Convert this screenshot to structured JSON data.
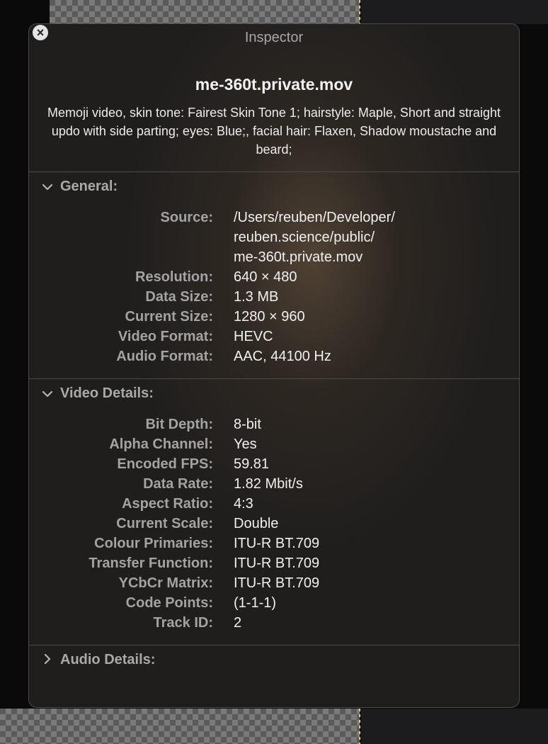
{
  "window": {
    "title": "Inspector",
    "close_label": "×"
  },
  "file": {
    "name": "me-360t.private.mov",
    "description": "Memoji video, skin tone: Fairest Skin Tone 1; hairstyle: Maple, Short and straight updo with side parting; eyes: Blue;, facial hair: Flaxen, Shadow moustache and beard;"
  },
  "sections": {
    "general": {
      "title": "General:",
      "expanded": true,
      "source": {
        "label": "Source:",
        "lines": [
          "/Users/reuben/Developer/",
          "reuben.science/public/",
          "me-360t.private.mov"
        ]
      },
      "rows": [
        {
          "label": "Resolution:",
          "value": "640 × 480"
        },
        {
          "label": "Data Size:",
          "value": "1.3 MB"
        },
        {
          "label": "Current Size:",
          "value": "1280 × 960"
        },
        {
          "label": "Video Format:",
          "value": "HEVC"
        },
        {
          "label": "Audio Format:",
          "value": "AAC, 44100 Hz"
        }
      ]
    },
    "video": {
      "title": "Video Details:",
      "expanded": true,
      "rows": [
        {
          "label": "Bit Depth:",
          "value": "8-bit"
        },
        {
          "label": "Alpha Channel:",
          "value": "Yes"
        },
        {
          "label": "Encoded FPS:",
          "value": "59.81"
        },
        {
          "label": "Data Rate:",
          "value": "1.82 Mbit/s"
        },
        {
          "label": "Aspect Ratio:",
          "value": "4:3"
        },
        {
          "label": "Current Scale:",
          "value": "Double"
        },
        {
          "label": "Colour Primaries:",
          "value": "ITU-R BT.709"
        },
        {
          "label": "Transfer Function:",
          "value": "ITU-R BT.709"
        },
        {
          "label": "YCbCr Matrix:",
          "value": "ITU-R BT.709"
        },
        {
          "label": "Code Points:",
          "value": "(1-1-1)"
        },
        {
          "label": "Track ID:",
          "value": "2"
        }
      ]
    },
    "audio": {
      "title": "Audio Details:",
      "expanded": false
    }
  },
  "colors": {
    "accent_line": "#e6d23a",
    "panel_bg": "#1f1e1d",
    "label": "#a3a3a3",
    "value": "#f0f0f0"
  }
}
